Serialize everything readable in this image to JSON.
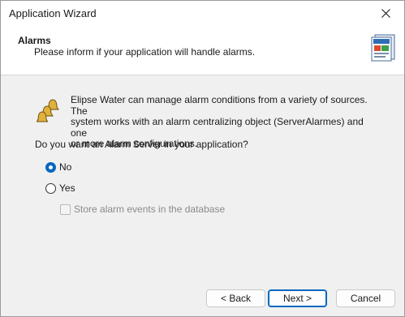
{
  "window": {
    "title": "Application Wizard"
  },
  "header": {
    "title": "Alarms",
    "subtitle": "Please inform if your application will handle alarms."
  },
  "content": {
    "description_lines": [
      "Elipse Water can manage alarm conditions from a variety of sources. The",
      "system works with an alarm centralizing object (ServerAlarmes) and one",
      "or more alarm configurations."
    ],
    "question": "Do you want an Alarm Server in your application?",
    "options": [
      {
        "label": "No",
        "selected": true
      },
      {
        "label": "Yes",
        "selected": false
      }
    ],
    "store_events": {
      "label": "Store alarm events in the database",
      "checked": false,
      "enabled": false
    }
  },
  "buttons": {
    "back": "< Back",
    "next": "Next >",
    "cancel": "Cancel"
  },
  "icons": {
    "header": "wizard-document-icon",
    "body": "alarm-bells-icon",
    "close": "close-icon"
  },
  "colors": {
    "accent": "#0067c0"
  }
}
